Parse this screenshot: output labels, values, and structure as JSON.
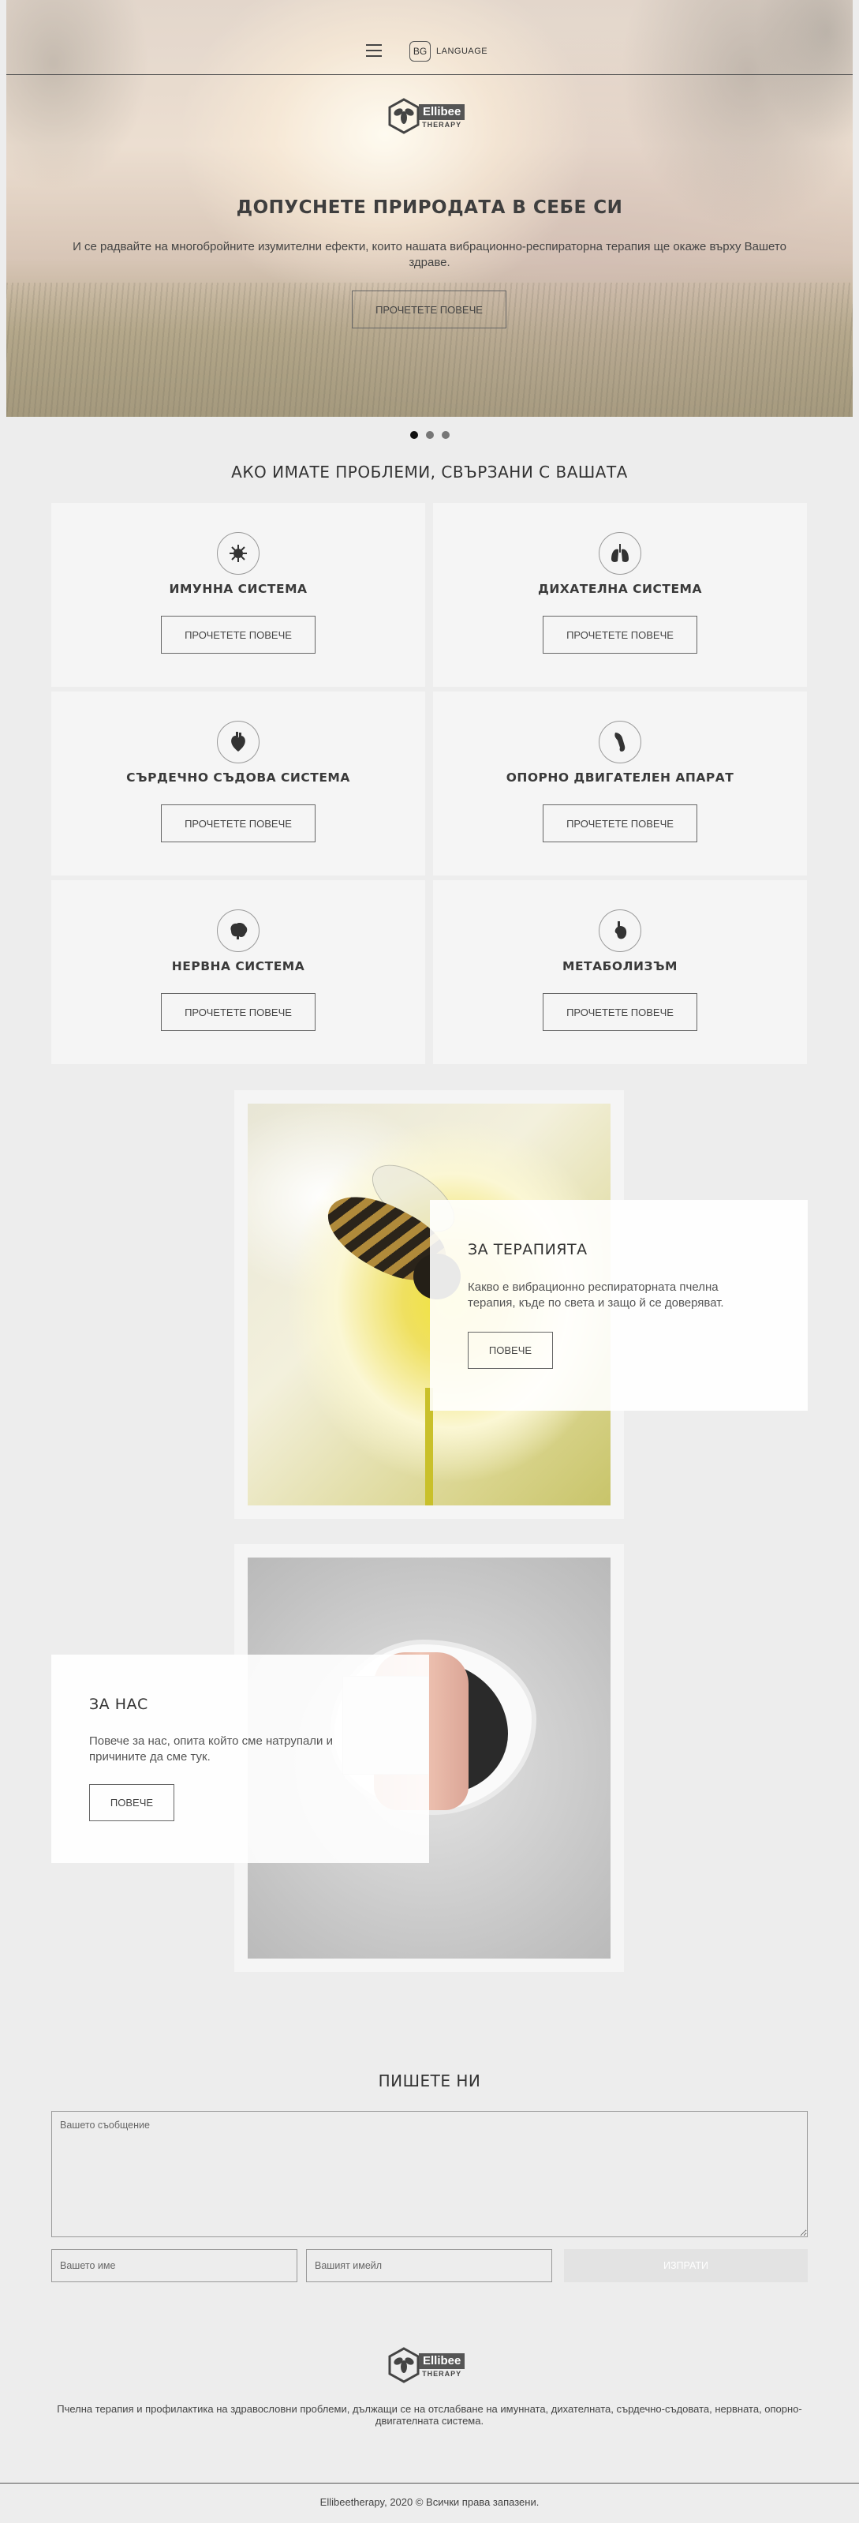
{
  "nav": {
    "language_code": "BG",
    "language_label": "LANGUAGE"
  },
  "logo": {
    "brand": "Ellibee",
    "sub": "THERAPY"
  },
  "hero": {
    "title": "ДОПУСНЕТЕ ПРИРОДАТА В СЕБЕ СИ",
    "text": "И се радвайте на многобройните изумителни ефекти, които нашата вибрационно-респираторна терапия ще окаже върху Вашето здраве.",
    "button": "ПРОЧЕТЕТЕ ПОВЕЧЕ",
    "slides": 3,
    "active_slide": 1
  },
  "problems": {
    "title": "АКО ИМАТЕ ПРОБЛЕМИ, СВЪРЗАНИ С ВАШАТА",
    "cards": [
      {
        "title": "ИМУННА СИСТЕМА",
        "icon": "virus-icon",
        "button": "ПРОЧЕТЕТЕ ПОВЕЧЕ"
      },
      {
        "title": "ДИХАТЕЛНА СИСТЕМА",
        "icon": "lungs-icon",
        "button": "ПРОЧЕТЕТЕ ПОВЕЧЕ"
      },
      {
        "title": "СЪРДЕЧНО СЪДОВА СИСТЕМА",
        "icon": "heart-icon",
        "button": "ПРОЧЕТЕТЕ ПОВЕЧЕ"
      },
      {
        "title": "ОПОРНО ДВИГАТЕЛЕН АПАРАТ",
        "icon": "bone-icon",
        "button": "ПРОЧЕТЕТЕ ПОВЕЧЕ"
      },
      {
        "title": "НЕРВНА СИСТЕМА",
        "icon": "brain-icon",
        "button": "ПРОЧЕТЕТЕ ПОВЕЧЕ"
      },
      {
        "title": "МЕТАБОЛИЗЪМ",
        "icon": "stomach-icon",
        "button": "ПРОЧЕТЕТЕ ПОВЕЧЕ"
      }
    ]
  },
  "therapy": {
    "title": "ЗА ТЕРАПИЯТА",
    "text": "Какво е вибрационно респираторната пчелна терапия, къде по света и защо й се доверяват.",
    "button": "ПОВЕЧЕ"
  },
  "about": {
    "title": "ЗА НАС",
    "text": "Повече за нас, опита който сме натрупали и причините да сме тук.",
    "button": "ПОВЕЧЕ"
  },
  "contact": {
    "title": "ПИШЕТЕ НИ",
    "message_placeholder": "Вашето съобщение",
    "name_placeholder": "Вашето име",
    "email_placeholder": "Вашият имейл",
    "send_button": "ИЗПРАТИ"
  },
  "footer": {
    "text": "Пчелна терапия и профилактика на здравословни проблеми, дължащи се на отслабване на имунната, дихателната, сърдечно-съдовата, нервната, опорно-двигателната система.",
    "copyright": "Ellibeetherapy, 2020 © Всички права запазени."
  },
  "colors": {
    "background": "#ededed",
    "card": "#f5f5f5",
    "text": "#444444",
    "logo_badge": "#555555"
  }
}
